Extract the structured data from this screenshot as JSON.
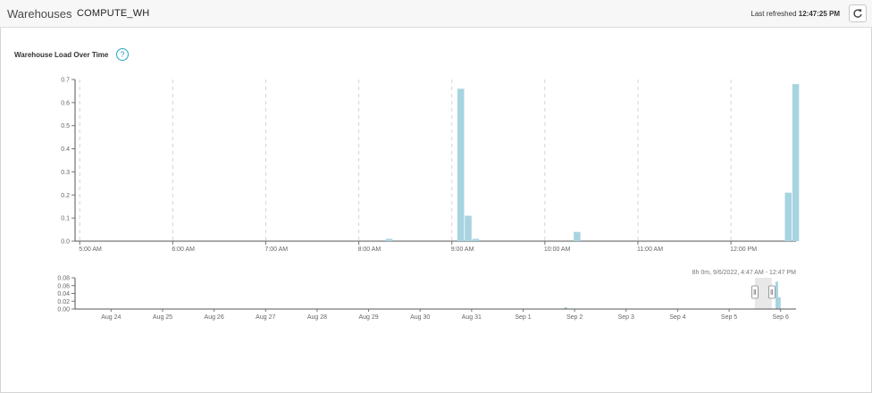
{
  "header": {
    "breadcrumb_root": "Warehouses",
    "breadcrumb_separator": "›",
    "breadcrumb_current": "COMPUTE_WH",
    "refresh_label": "Last refreshed",
    "refresh_time": "12:47:25 PM",
    "refresh_icon": "refresh-icon"
  },
  "section": {
    "title": "Warehouse Load Over Time",
    "help_icon": "?"
  },
  "colors": {
    "bar": "#a7d4e0",
    "accent": "#29a3c9"
  },
  "chart_data": [
    {
      "type": "bar",
      "title": "",
      "xlabel": "",
      "ylabel": "",
      "ylim": [
        0,
        0.7
      ],
      "y_ticks": [
        "0.0",
        "0.1",
        "0.2",
        "0.3",
        "0.4",
        "0.5",
        "0.6",
        "0.7"
      ],
      "x_ticks": [
        "5:00 AM",
        "6:00 AM",
        "7:00 AM",
        "8:00 AM",
        "9:00 AM",
        "10:00 AM",
        "11:00 AM",
        "12:00 PM"
      ],
      "x_range_hours": [
        4.95,
        12.7
      ],
      "grid": "vertical dashed",
      "bars": [
        {
          "t": 8.29,
          "value": 0.01
        },
        {
          "t": 9.06,
          "value": 0.66
        },
        {
          "t": 9.14,
          "value": 0.11
        },
        {
          "t": 9.22,
          "value": 0.01
        },
        {
          "t": 10.31,
          "value": 0.04
        },
        {
          "t": 12.58,
          "value": 0.21
        },
        {
          "t": 12.66,
          "value": 0.68
        }
      ]
    },
    {
      "type": "bar",
      "title": "",
      "range_label": "8h 0m, 9/6/2022, 4:47 AM - 12:47 PM",
      "ylim": [
        0,
        0.08
      ],
      "y_ticks": [
        "0.00",
        "0.02",
        "0.04",
        "0.06",
        "0.08"
      ],
      "x_ticks": [
        "Aug 24",
        "Aug 25",
        "Aug 26",
        "Aug 27",
        "Aug 28",
        "Aug 29",
        "Aug 30",
        "Aug 31",
        "Sep 1",
        "Sep 2",
        "Sep 3",
        "Sep 4",
        "Sep 5",
        "Sep 6"
      ],
      "bars": [
        {
          "day": 9.5,
          "value": 0.005
        },
        {
          "day": 13.6,
          "value": 0.07
        },
        {
          "day": 13.65,
          "value": 0.03
        }
      ],
      "selection_days": [
        13.2,
        13.53
      ]
    }
  ]
}
